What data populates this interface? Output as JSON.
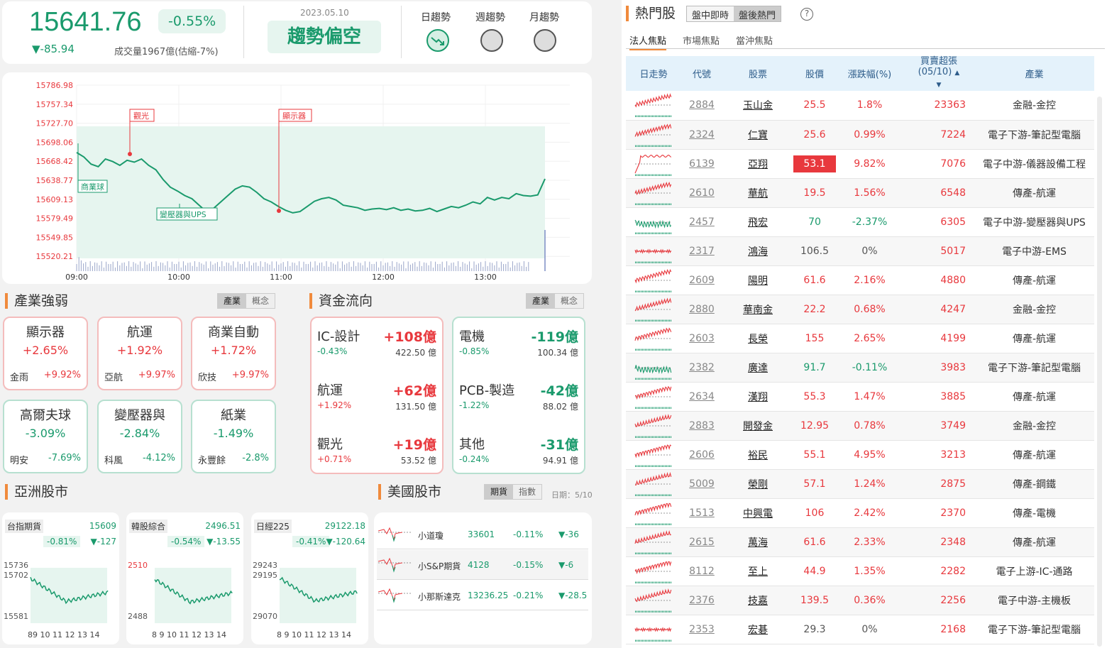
{
  "index": {
    "value": "15641.76",
    "pct": "-0.55%",
    "change": "▼-85.94",
    "volume": "成交量1967億(估縮-7%)",
    "date": "2023.05.10",
    "trend": "趨勢偏空"
  },
  "trend_tabs": {
    "day": "日趨勢",
    "week": "週趨勢",
    "month": "月趨勢"
  },
  "chart_data": {
    "type": "line",
    "title": "",
    "y_ticks": [
      "15786.98",
      "15757.34",
      "15727.70",
      "15698.06",
      "15668.42",
      "15638.77",
      "15609.13",
      "15579.49",
      "15549.85",
      "15520.21"
    ],
    "x_ticks": [
      "09:00",
      "10:00",
      "11:00",
      "12:00",
      "13:00"
    ],
    "ylim": [
      15520.21,
      15786.98
    ],
    "series": [
      {
        "values": [
          15682,
          15675,
          15664,
          15660,
          15672,
          15668,
          15662,
          15670,
          15667,
          15672,
          15662,
          15655,
          15640,
          15628,
          15622,
          15615,
          15610,
          15600,
          15590,
          15595,
          15605,
          15615,
          15625,
          15630,
          15628,
          15620,
          15610,
          15605,
          15598,
          15592,
          15588,
          15590,
          15598,
          15606,
          15610,
          15612,
          15608,
          15600,
          15598,
          15596,
          15592,
          15594,
          15595,
          15593,
          15596,
          15592,
          15594,
          15591,
          15592,
          15595,
          15590,
          15594,
          15598,
          15596,
          15600,
          15605,
          15602,
          15612,
          15608,
          15612,
          15610,
          15618,
          15615,
          15614,
          15616,
          15641
        ]
      }
    ],
    "annotations": [
      "觀光",
      "顯示器",
      "商業球",
      "變壓器與UPS"
    ]
  },
  "industry": {
    "title": "產業強弱",
    "seg": [
      "產業",
      "概念"
    ],
    "items": [
      {
        "name": "顯示器",
        "pct": "+2.65%",
        "stock": "金雨",
        "spct": "+9.92%",
        "up": true
      },
      {
        "name": "航運",
        "pct": "+1.92%",
        "stock": "亞航",
        "spct": "+9.97%",
        "up": true
      },
      {
        "name": "商業自動",
        "pct": "+1.72%",
        "stock": "欣技",
        "spct": "+9.97%",
        "up": true
      },
      {
        "name": "高爾夫球",
        "pct": "-3.09%",
        "stock": "明安",
        "spct": "-7.69%",
        "up": false
      },
      {
        "name": "變壓器與",
        "pct": "-2.84%",
        "stock": "科風",
        "spct": "-4.12%",
        "up": false
      },
      {
        "name": "紙業",
        "pct": "-1.49%",
        "stock": "永豐餘",
        "spct": "-2.8%",
        "up": false
      }
    ]
  },
  "flow": {
    "title": "資金流向",
    "seg": [
      "產業",
      "概念"
    ],
    "left": [
      {
        "name": "IC-設計",
        "val": "+108億",
        "pct": "-0.43%",
        "amt": "422.50 億"
      },
      {
        "name": "航運",
        "val": "+62億",
        "pct": "+1.92%",
        "amt": "131.50 億"
      },
      {
        "name": "觀光",
        "val": "+19億",
        "pct": "+0.71%",
        "amt": "53.52 億"
      }
    ],
    "right": [
      {
        "name": "電機",
        "val": "-119億",
        "pct": "-0.85%",
        "amt": "100.34 億"
      },
      {
        "name": "PCB-製造",
        "val": "-42億",
        "pct": "-1.22%",
        "amt": "88.02 億"
      },
      {
        "name": "其他",
        "val": "-31億",
        "pct": "-0.24%",
        "amt": "94.91 億"
      }
    ]
  },
  "asia": {
    "title": "亞洲股市",
    "items": [
      {
        "name": "台指期貨",
        "val": "15609",
        "pct": "-0.81%",
        "chg": "▼-127",
        "hi": "15736",
        "mid": "15702",
        "lo": "15581",
        "x": "89 10 11 12 13 14"
      },
      {
        "name": "韓股綜合",
        "val": "2496.51",
        "pct": "-0.54%",
        "chg": "▼-13.55",
        "hi": "",
        "mid": "2510",
        "lo": "2488",
        "x": "8 9 10 11 12 13 14"
      },
      {
        "name": "日經225",
        "val": "29122.18",
        "pct": "-0.41%",
        "chg": "▼-120.64",
        "hi": "29243",
        "mid": "29195",
        "lo": "29070",
        "x": "8 9 10 11 12 13 14"
      }
    ]
  },
  "us": {
    "title": "美國股市",
    "seg": [
      "期貨",
      "指數"
    ],
    "date": "日期：5/10",
    "items": [
      {
        "name": "小道瓊",
        "val": "33601",
        "pct": "-0.11%",
        "chg": "▼-36"
      },
      {
        "name": "小S&P期貨",
        "val": "4128",
        "pct": "-0.15%",
        "chg": "▼-6"
      },
      {
        "name": "小那斯達克",
        "val": "13236.25",
        "pct": "-0.21%",
        "chg": "▼-28.5"
      }
    ]
  },
  "hot": {
    "title": "熱門股",
    "tabs_top": [
      "盤中即時",
      "盤後熱門"
    ],
    "help": "?",
    "tabs": [
      "法人焦點",
      "市場焦點",
      "當沖焦點"
    ],
    "headers": [
      "日走勢",
      "代號",
      "股票",
      "股價",
      "漲跌幅(%)",
      "買賣超張\n(05/10)",
      "產業"
    ],
    "rows": [
      [
        "2884",
        "玉山金",
        "25.5",
        "1.8%",
        "23363",
        "金融-金控",
        "u"
      ],
      [
        "2324",
        "仁寶",
        "25.6",
        "0.99%",
        "7224",
        "電子下游-筆記型電腦",
        "u"
      ],
      [
        "6139",
        "亞翔",
        "53.1",
        "9.82%",
        "7076",
        "電子中游-儀器設備工程",
        "L"
      ],
      [
        "2610",
        "華航",
        "19.5",
        "1.56%",
        "6548",
        "傳產-航運",
        "u"
      ],
      [
        "2457",
        "飛宏",
        "70",
        "-2.37%",
        "6305",
        "電子中游-變壓器與UPS",
        "d"
      ],
      [
        "2317",
        "鴻海",
        "106.5",
        "0%",
        "5017",
        "電子中游-EMS",
        "f"
      ],
      [
        "2609",
        "陽明",
        "61.6",
        "2.16%",
        "4880",
        "傳產-航運",
        "u"
      ],
      [
        "2880",
        "華南金",
        "22.2",
        "0.68%",
        "4247",
        "金融-金控",
        "u"
      ],
      [
        "2603",
        "長榮",
        "155",
        "2.65%",
        "4199",
        "傳產-航運",
        "u"
      ],
      [
        "2382",
        "廣達",
        "91.7",
        "-0.11%",
        "3983",
        "電子下游-筆記型電腦",
        "d"
      ],
      [
        "2634",
        "漢翔",
        "55.3",
        "1.47%",
        "3885",
        "傳產-航運",
        "u"
      ],
      [
        "2883",
        "開發金",
        "12.95",
        "0.78%",
        "3749",
        "金融-金控",
        "u"
      ],
      [
        "2606",
        "裕民",
        "55.1",
        "4.95%",
        "3213",
        "傳產-航運",
        "u"
      ],
      [
        "5009",
        "榮剛",
        "57.1",
        "1.24%",
        "2875",
        "傳產-鋼鐵",
        "u"
      ],
      [
        "1513",
        "中興電",
        "106",
        "2.42%",
        "2370",
        "傳產-電機",
        "u"
      ],
      [
        "2615",
        "萬海",
        "61.6",
        "2.33%",
        "2348",
        "傳產-航運",
        "u"
      ],
      [
        "8112",
        "至上",
        "44.9",
        "1.35%",
        "2282",
        "電子上游-IC-通路",
        "u"
      ],
      [
        "2376",
        "技嘉",
        "139.5",
        "0.36%",
        "2256",
        "電子中游-主機板",
        "u"
      ],
      [
        "2353",
        "宏碁",
        "29.3",
        "0%",
        "2168",
        "電子下游-筆記型電腦",
        "f"
      ]
    ]
  },
  "colors": {
    "up": "#e8383d",
    "down": "#1a9a6c",
    "accent": "#f08a3c",
    "fill": "#e6f5ef"
  }
}
